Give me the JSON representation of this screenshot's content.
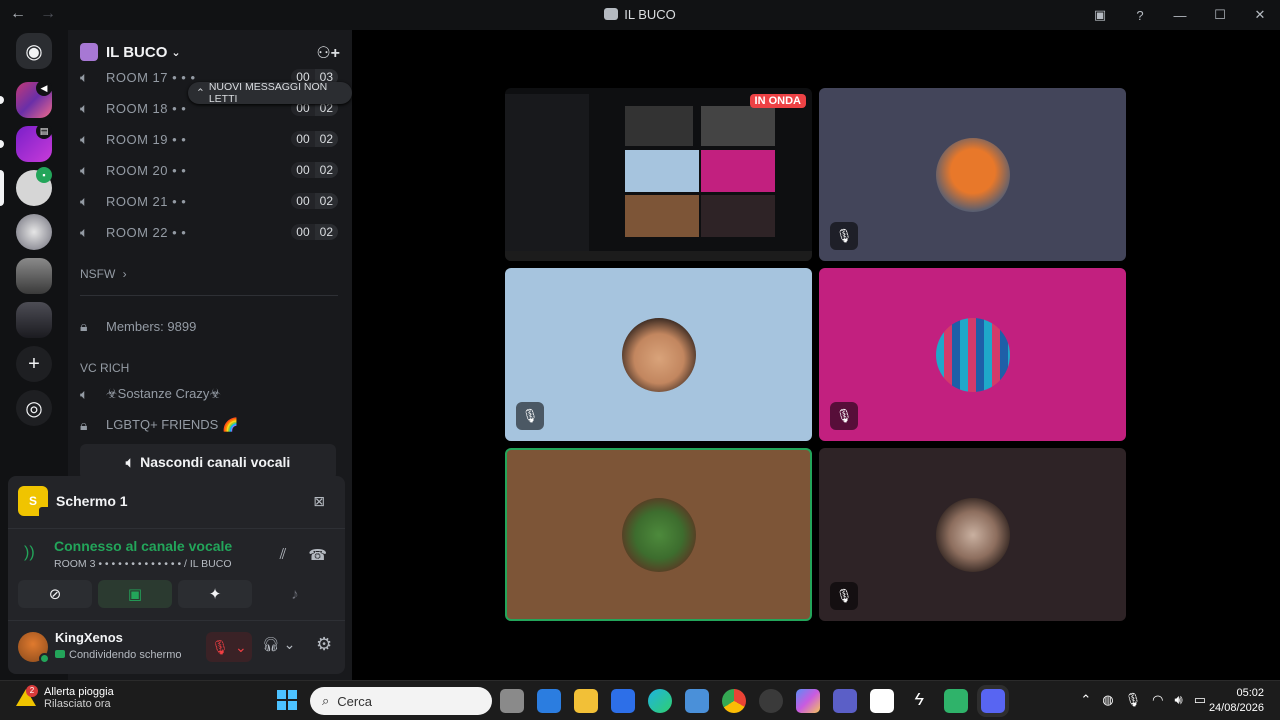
{
  "window": {
    "title": "IL BUCO",
    "back_icon": "arrow-left",
    "forward_icon": "arrow-right"
  },
  "server": {
    "name": "IL BUCO",
    "unread_pill": "NUOVI MESSAGGI NON LETTI",
    "voice_rooms": [
      {
        "name": "ROOM 17 • • •",
        "count_a": "00",
        "count_b": "03"
      },
      {
        "name": "ROOM 18 • •",
        "count_a": "00",
        "count_b": "02"
      },
      {
        "name": "ROOM 19 • •",
        "count_a": "00",
        "count_b": "02"
      },
      {
        "name": "ROOM 20 • •",
        "count_a": "00",
        "count_b": "02"
      },
      {
        "name": "ROOM 21 • •",
        "count_a": "00",
        "count_b": "02"
      },
      {
        "name": "ROOM 22 • •",
        "count_a": "00",
        "count_b": "02"
      }
    ],
    "nsfw_category": "NSFW",
    "members_channel": "Members: 9899",
    "vc_rich_category": "VC RICH",
    "sostanze_channel": "☣Sostanze Crazy☣",
    "lgbtq_channel": "LGBTQ+ FRIENDS 🌈",
    "hide_voice_button": "Nascondi canali vocali"
  },
  "panel": {
    "stream_title": "Schermo 1",
    "stream_badge": "S",
    "voice_status": "Connesso al canale vocale",
    "voice_location": "ROOM 3 • • • • • • • • • • • • • / IL BUCO",
    "username": "KingXenos",
    "user_status": "Condividendo schermo"
  },
  "stage": {
    "live_badge": "IN ONDA"
  },
  "taskbar": {
    "weather_title": "Allerta pioggia",
    "weather_sub": "Rilasciato ora",
    "weather_badge": "2",
    "search_placeholder": "Cerca",
    "time": "05:02",
    "date": "24/08/2026"
  },
  "colors": {
    "accent_green": "#23a55a",
    "danger_red": "#ed4245",
    "tile_light_blue": "#a6c4de",
    "tile_magenta": "#c2207f",
    "tile_brown": "#7d5537",
    "tile_dark": "#2e2326",
    "tile_slate": "#43455a"
  }
}
